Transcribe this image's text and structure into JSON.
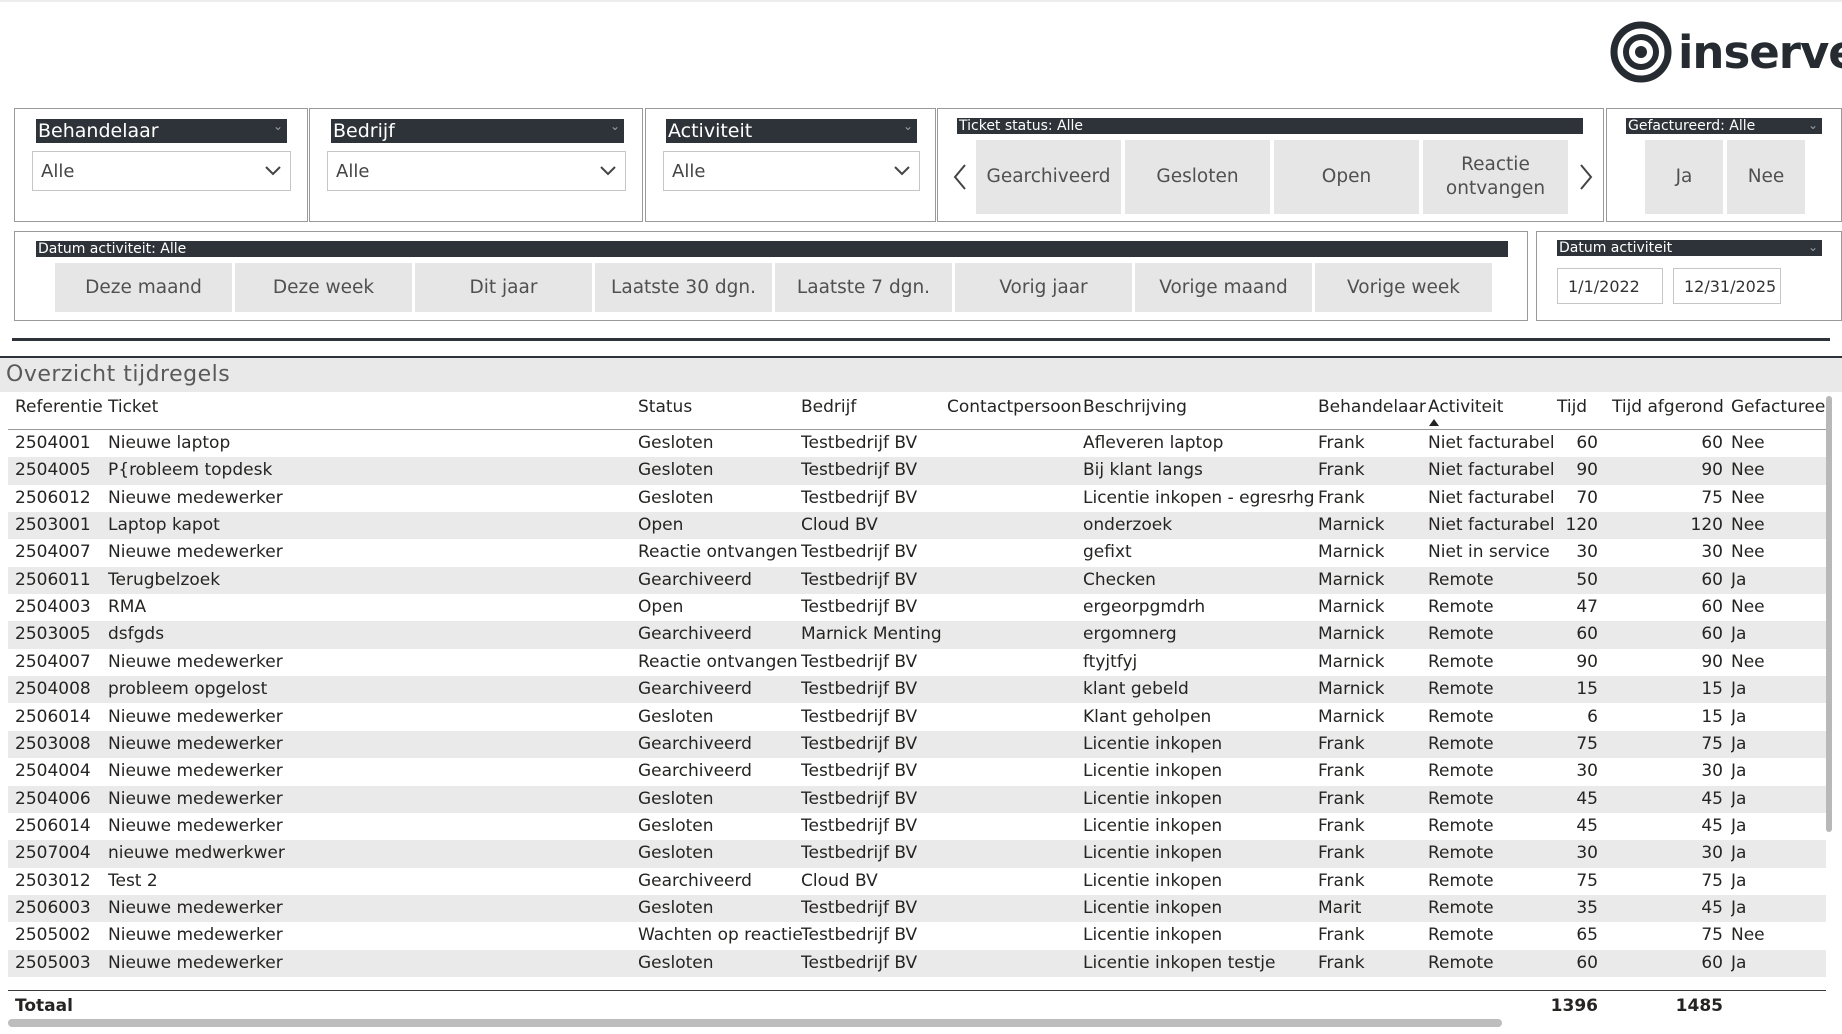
{
  "brand": {
    "logo_text": "inserve",
    "logo_color": "#252b30"
  },
  "colors": {
    "header_dark": "#2d3338",
    "tile_bg": "#e6e6e6",
    "row_alt": "#eaeaea"
  },
  "filters": {
    "behandelaar": {
      "label": "Behandelaar",
      "value": "Alle"
    },
    "bedrijf": {
      "label": "Bedrijf",
      "value": "Alle"
    },
    "activiteit": {
      "label": "Activiteit",
      "value": "Alle"
    },
    "ticket_status": {
      "label": "Ticket status: Alle",
      "options": [
        "Gearchiveerd",
        "Gesloten",
        "Open",
        "Reactie ontvangen"
      ]
    },
    "gefactureerd": {
      "label": "Gefactureerd: Alle",
      "options": [
        "Ja",
        "Nee"
      ]
    },
    "datum_activiteit_preset": {
      "label": "Datum activiteit: Alle",
      "options": [
        "Deze maand",
        "Deze week",
        "Dit jaar",
        "Laatste 30 dgn.",
        "Laatste 7 dgn.",
        "Vorig jaar",
        "Vorige maand",
        "Vorige week"
      ]
    },
    "datum_activiteit_range": {
      "label": "Datum activiteit",
      "start": "1/1/2022",
      "end": "12/31/2025"
    }
  },
  "table": {
    "title": "Overzicht tijdregels",
    "sorted_column": "Activiteit",
    "columns": [
      "Referentie",
      "Ticket",
      "Status",
      "Bedrijf",
      "Contactpersoon",
      "Beschrijving",
      "Behandelaar",
      "Activiteit",
      "Tijd",
      "Tijd afgerond",
      "Gefactureerd"
    ],
    "rows": [
      {
        "ref": "2504001",
        "ticket": "Nieuwe laptop",
        "status": "Gesloten",
        "bedrijf": "Testbedrijf BV",
        "contact": "",
        "beschrijving": "Afleveren laptop",
        "behandelaar": "Frank",
        "activiteit": "Niet facturabel",
        "tijd": "60",
        "afgerond": "60",
        "gefactureerd": "Nee"
      },
      {
        "ref": "2504005",
        "ticket": "P{robleem topdesk",
        "status": "Gesloten",
        "bedrijf": "Testbedrijf BV",
        "contact": "",
        "beschrijving": "Bij klant langs",
        "behandelaar": "Frank",
        "activiteit": "Niet facturabel",
        "tijd": "90",
        "afgerond": "90",
        "gefactureerd": "Nee"
      },
      {
        "ref": "2506012",
        "ticket": "Nieuwe medewerker",
        "status": "Gesloten",
        "bedrijf": "Testbedrijf BV",
        "contact": "",
        "beschrijving": "Licentie inkopen - egresrhg",
        "behandelaar": "Frank",
        "activiteit": "Niet facturabel",
        "tijd": "70",
        "afgerond": "75",
        "gefactureerd": "Nee"
      },
      {
        "ref": "2503001",
        "ticket": "Laptop kapot",
        "status": "Open",
        "bedrijf": "Cloud BV",
        "contact": "",
        "beschrijving": "onderzoek",
        "behandelaar": "Marnick",
        "activiteit": "Niet facturabel",
        "tijd": "120",
        "afgerond": "120",
        "gefactureerd": "Nee"
      },
      {
        "ref": "2504007",
        "ticket": "Nieuwe medewerker",
        "status": "Reactie ontvangen",
        "bedrijf": "Testbedrijf BV",
        "contact": "",
        "beschrijving": "gefixt",
        "behandelaar": "Marnick",
        "activiteit": "Niet in service",
        "tijd": "30",
        "afgerond": "30",
        "gefactureerd": "Nee"
      },
      {
        "ref": "2506011",
        "ticket": "Terugbelzoek",
        "status": "Gearchiveerd",
        "bedrijf": "Testbedrijf BV",
        "contact": "",
        "beschrijving": "Checken",
        "behandelaar": "Marnick",
        "activiteit": "Remote",
        "tijd": "50",
        "afgerond": "60",
        "gefactureerd": "Ja"
      },
      {
        "ref": "2504003",
        "ticket": "RMA",
        "status": "Open",
        "bedrijf": "Testbedrijf BV",
        "contact": "",
        "beschrijving": "ergeorpgmdrh",
        "behandelaar": "Marnick",
        "activiteit": "Remote",
        "tijd": "47",
        "afgerond": "60",
        "gefactureerd": "Nee"
      },
      {
        "ref": "2503005",
        "ticket": "dsfgds",
        "status": "Gearchiveerd",
        "bedrijf": "Marnick Menting",
        "contact": "",
        "beschrijving": "ergomnerg",
        "behandelaar": "Marnick",
        "activiteit": "Remote",
        "tijd": "60",
        "afgerond": "60",
        "gefactureerd": "Ja"
      },
      {
        "ref": "2504007",
        "ticket": "Nieuwe medewerker",
        "status": "Reactie ontvangen",
        "bedrijf": "Testbedrijf BV",
        "contact": "",
        "beschrijving": "ftyjtfyj",
        "behandelaar": "Marnick",
        "activiteit": "Remote",
        "tijd": "90",
        "afgerond": "90",
        "gefactureerd": "Nee"
      },
      {
        "ref": "2504008",
        "ticket": "probleem opgelost",
        "status": "Gearchiveerd",
        "bedrijf": "Testbedrijf BV",
        "contact": "",
        "beschrijving": "klant gebeld",
        "behandelaar": "Marnick",
        "activiteit": "Remote",
        "tijd": "15",
        "afgerond": "15",
        "gefactureerd": "Ja"
      },
      {
        "ref": "2506014",
        "ticket": "Nieuwe medewerker",
        "status": "Gesloten",
        "bedrijf": "Testbedrijf BV",
        "contact": "",
        "beschrijving": "Klant geholpen",
        "behandelaar": "Marnick",
        "activiteit": "Remote",
        "tijd": "6",
        "afgerond": "15",
        "gefactureerd": "Ja"
      },
      {
        "ref": "2503008",
        "ticket": "Nieuwe medewerker",
        "status": "Gearchiveerd",
        "bedrijf": "Testbedrijf BV",
        "contact": "",
        "beschrijving": "Licentie inkopen",
        "behandelaar": "Frank",
        "activiteit": "Remote",
        "tijd": "75",
        "afgerond": "75",
        "gefactureerd": "Ja"
      },
      {
        "ref": "2504004",
        "ticket": "Nieuwe medewerker",
        "status": "Gearchiveerd",
        "bedrijf": "Testbedrijf BV",
        "contact": "",
        "beschrijving": "Licentie inkopen",
        "behandelaar": "Frank",
        "activiteit": "Remote",
        "tijd": "30",
        "afgerond": "30",
        "gefactureerd": "Ja"
      },
      {
        "ref": "2504006",
        "ticket": "Nieuwe medewerker",
        "status": "Gesloten",
        "bedrijf": "Testbedrijf BV",
        "contact": "",
        "beschrijving": "Licentie inkopen",
        "behandelaar": "Frank",
        "activiteit": "Remote",
        "tijd": "45",
        "afgerond": "45",
        "gefactureerd": "Ja"
      },
      {
        "ref": "2506014",
        "ticket": "Nieuwe medewerker",
        "status": "Gesloten",
        "bedrijf": "Testbedrijf BV",
        "contact": "",
        "beschrijving": "Licentie inkopen",
        "behandelaar": "Frank",
        "activiteit": "Remote",
        "tijd": "45",
        "afgerond": "45",
        "gefactureerd": "Ja"
      },
      {
        "ref": "2507004",
        "ticket": "nieuwe medwerkwer",
        "status": "Gesloten",
        "bedrijf": "Testbedrijf BV",
        "contact": "",
        "beschrijving": "Licentie inkopen",
        "behandelaar": "Frank",
        "activiteit": "Remote",
        "tijd": "30",
        "afgerond": "30",
        "gefactureerd": "Ja"
      },
      {
        "ref": "2503012",
        "ticket": "Test 2",
        "status": "Gearchiveerd",
        "bedrijf": "Cloud BV",
        "contact": "",
        "beschrijving": "Licentie inkopen",
        "behandelaar": "Frank",
        "activiteit": "Remote",
        "tijd": "75",
        "afgerond": "75",
        "gefactureerd": "Ja"
      },
      {
        "ref": "2506003",
        "ticket": "Nieuwe medewerker",
        "status": "Gesloten",
        "bedrijf": "Testbedrijf BV",
        "contact": "",
        "beschrijving": "Licentie inkopen",
        "behandelaar": "Marit",
        "activiteit": "Remote",
        "tijd": "35",
        "afgerond": "45",
        "gefactureerd": "Ja"
      },
      {
        "ref": "2505002",
        "ticket": "Nieuwe medewerker",
        "status": "Wachten op reactie",
        "bedrijf": "Testbedrijf BV",
        "contact": "",
        "beschrijving": "Licentie inkopen",
        "behandelaar": "Frank",
        "activiteit": "Remote",
        "tijd": "65",
        "afgerond": "75",
        "gefactureerd": "Nee"
      },
      {
        "ref": "2505003",
        "ticket": "Nieuwe medewerker",
        "status": "Gesloten",
        "bedrijf": "Testbedrijf BV",
        "contact": "",
        "beschrijving": "Licentie inkopen testje",
        "behandelaar": "Frank",
        "activiteit": "Remote",
        "tijd": "60",
        "afgerond": "60",
        "gefactureerd": "Ja"
      }
    ],
    "total": {
      "label": "Totaal",
      "tijd": "1396",
      "afgerond": "1485"
    }
  }
}
